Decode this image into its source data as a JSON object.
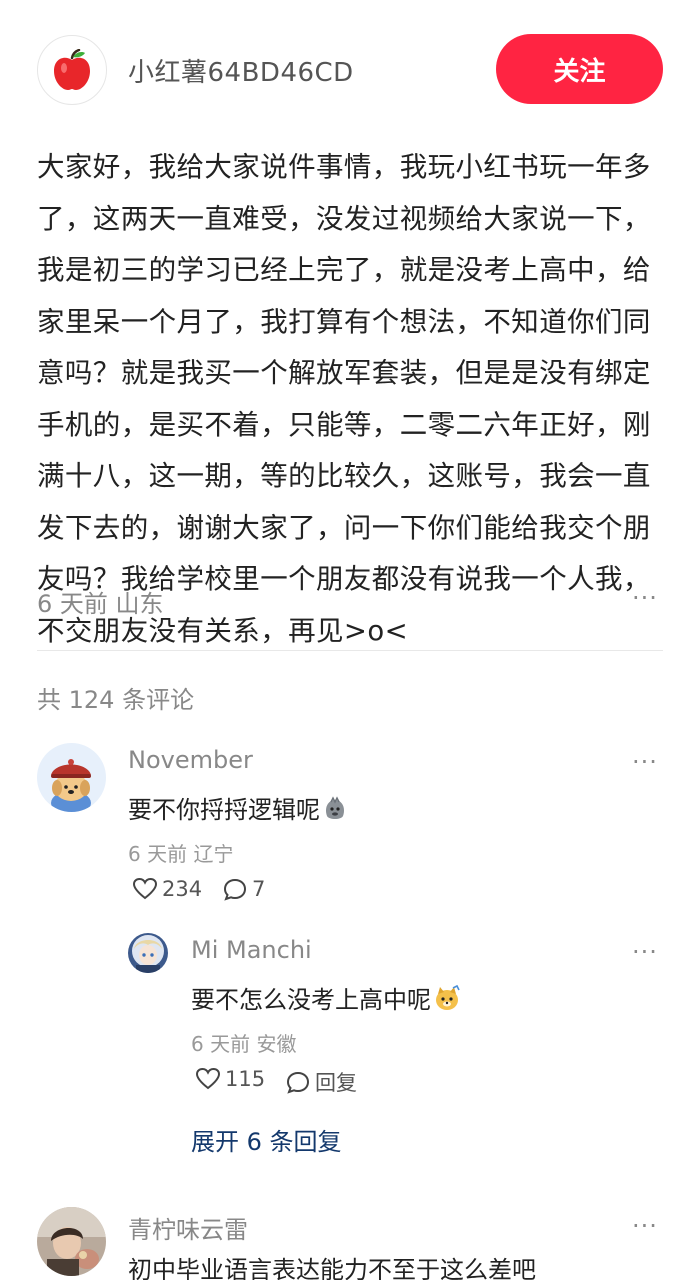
{
  "author": {
    "name": "小红薯64BD46CD",
    "avatar_icon": "apple-icon",
    "follow_label": "关注"
  },
  "post": {
    "lines": [
      "大家好，我给大家说件事情，我玩小红书玩一年多",
      "了，这两天一直难受，没发过视频给大家说一下，",
      "我是初三的学习已经上完了，就是没考上高中，给",
      "家里呆一个月了，我打算有个想法，不知道你们同",
      "意吗？就是我买一个解放军套装，但是是没有绑定",
      "手机的，是买不着，只能等，二零二六年正好，刚",
      "满十八，这一期，等的比较久，这账号，我会一直",
      "发下去的，谢谢大家了，问一下你们能给我交个朋",
      "友吗？我给学校里一个朋友都没有说我一个人我，",
      "不交朋友没有关系，再见>o<"
    ],
    "meta": "6 天前 山东",
    "more_label": "···"
  },
  "comments_header": "共 124 条评论",
  "comments": [
    {
      "name": "November",
      "text": "要不你捋捋逻辑呢",
      "emoji_icon": "stone-face-emoji-icon",
      "meta": "6 天前 辽宁",
      "likes": "234",
      "replies_count": "7",
      "more_label": "···"
    },
    {
      "name": "青柠味云雷",
      "text": "初中毕业语言表达能力不至于这么差吧",
      "more_label": "···"
    }
  ],
  "reply": {
    "name": "Mi Manchi",
    "text": "要不怎么没考上高中呢",
    "emoji_icon": "doge-emoji-icon",
    "meta": "6 天前 安徽",
    "likes": "115",
    "reply_label": "回复",
    "more_label": "···"
  },
  "expand_label": "展开 6 条回复",
  "colors": {
    "accent": "#ff2442",
    "link": "#13386c",
    "muted": "#888888"
  }
}
